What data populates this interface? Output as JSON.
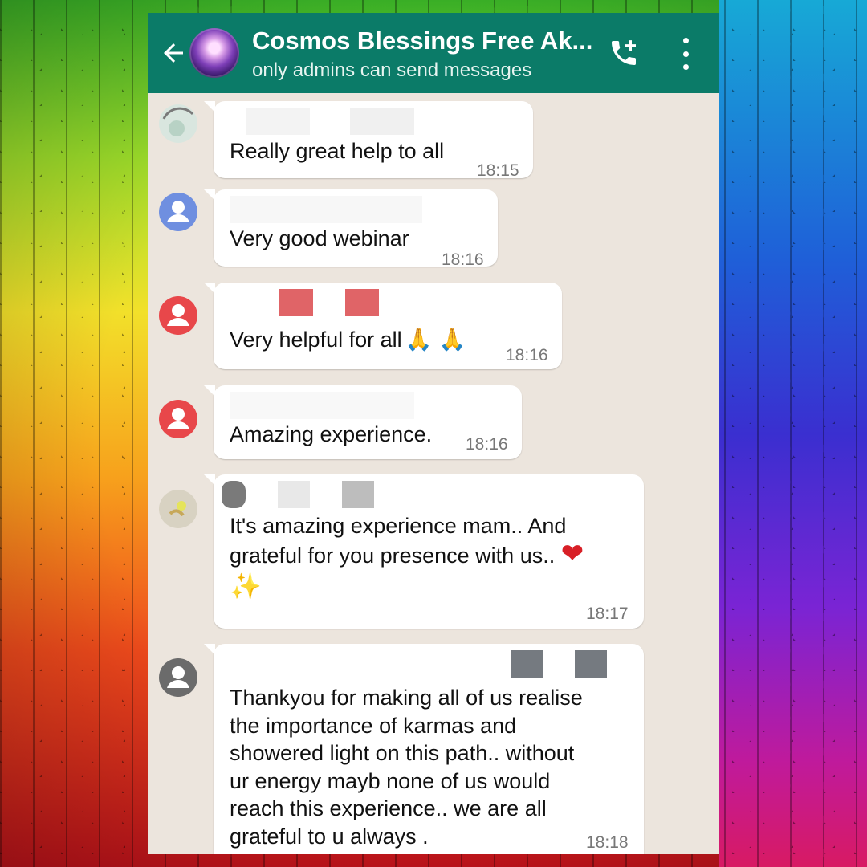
{
  "header": {
    "title": "Cosmos Blessings Free Ak...",
    "subtitle": "only admins can send messages",
    "back_icon": "arrow-left-icon",
    "call_icon": "add-call-icon",
    "menu_icon": "more-vertical-icon"
  },
  "colors": {
    "header_bg": "#0b7b68",
    "chat_bg": "#ece5dd",
    "bubble_bg": "#ffffff",
    "avatar_blue": "#6f8fe0",
    "avatar_red": "#e8474a",
    "avatar_gray": "#6b6b6b"
  },
  "messages": [
    {
      "text": "Really great help to all",
      "time": "18:15"
    },
    {
      "text": "Very good webinar",
      "time": "18:16"
    },
    {
      "text": "Very helpful for all",
      "emoji": "🙏 🙏",
      "time": "18:16"
    },
    {
      "text": "Amazing experience.",
      "time": "18:16"
    },
    {
      "text_line1": "It's amazing experience mam.. And",
      "text_line2": "grateful for you presence with us..",
      "emoji_heart": "❤",
      "emoji_sparkles": "✨",
      "time": "18:17"
    },
    {
      "lines": [
        "Thankyou for making all of us realise",
        "the importance of karmas and",
        "showered light on this path.. without",
        "ur energy mayb none of us would",
        "reach this experience.. we are all",
        "grateful to u always ."
      ],
      "time": "18:18"
    }
  ]
}
